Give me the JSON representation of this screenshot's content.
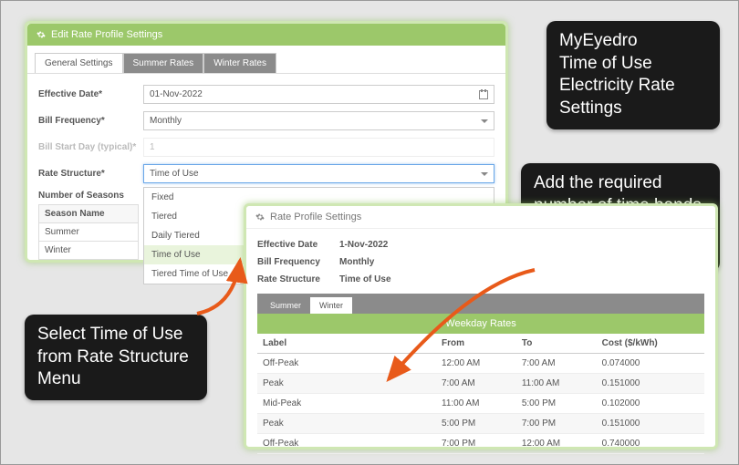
{
  "callouts": {
    "topRight": "MyEyedro\nTime of Use\nElectricity Rate\nSettings",
    "left": "Select Time of Use\nfrom Rate Structure\nMenu",
    "right": "Add the required\nnumber of time bands\n(select Edit Rate\nProfile Settings)"
  },
  "panel1": {
    "title": "Edit Rate Profile Settings",
    "tabs": [
      "General Settings",
      "Summer Rates",
      "Winter Rates"
    ],
    "activeTab": 0,
    "fields": {
      "effectiveDate": {
        "label": "Effective Date*",
        "value": "01-Nov-2022"
      },
      "billFrequency": {
        "label": "Bill Frequency*",
        "value": "Monthly"
      },
      "billStartDay": {
        "label": "Bill Start Day (typical)*",
        "value": "1"
      },
      "rateStructure": {
        "label": "Rate Structure*",
        "value": "Time of Use"
      },
      "numSeasons": {
        "label": "Number of Seasons"
      }
    },
    "rateStructureOptions": [
      "Fixed",
      "Tiered",
      "Daily Tiered",
      "Time of Use",
      "Tiered Time of Use"
    ],
    "rateStructureHighlight": 3,
    "seasonHeader": "Season Name",
    "seasons": [
      "Summer",
      "Winter"
    ]
  },
  "panel2": {
    "title": "Rate Profile Settings",
    "fields": {
      "effectiveDate": {
        "label": "Effective Date",
        "value": "1-Nov-2022"
      },
      "billFrequency": {
        "label": "Bill Frequency",
        "value": "Monthly"
      },
      "rateStructure": {
        "label": "Rate Structure",
        "value": "Time of Use"
      }
    },
    "tabs": [
      "Summer",
      "Winter"
    ],
    "activeTab": 1,
    "ratesTitle": "Weekday Rates",
    "columns": [
      "Label",
      "From",
      "To",
      "Cost ($/kWh)"
    ],
    "rows": [
      {
        "label": "Off-Peak",
        "from": "12:00 AM",
        "to": "7:00 AM",
        "cost": "0.074000"
      },
      {
        "label": "Peak",
        "from": "7:00 AM",
        "to": "11:00 AM",
        "cost": "0.151000"
      },
      {
        "label": "Mid-Peak",
        "from": "11:00 AM",
        "to": "5:00 PM",
        "cost": "0.102000"
      },
      {
        "label": "Peak",
        "from": "5:00 PM",
        "to": "7:00 PM",
        "cost": "0.151000"
      },
      {
        "label": "Off-Peak",
        "from": "7:00 PM",
        "to": "12:00 AM",
        "cost": "0.740000"
      }
    ]
  },
  "chart_data": {
    "type": "table",
    "title": "Weekday Rates",
    "columns": [
      "Label",
      "From",
      "To",
      "Cost ($/kWh)"
    ],
    "rows": [
      [
        "Off-Peak",
        "12:00 AM",
        "7:00 AM",
        0.074
      ],
      [
        "Peak",
        "7:00 AM",
        "11:00 AM",
        0.151
      ],
      [
        "Mid-Peak",
        "11:00 AM",
        "5:00 PM",
        0.102
      ],
      [
        "Peak",
        "5:00 PM",
        "7:00 PM",
        0.151
      ],
      [
        "Off-Peak",
        "7:00 PM",
        "12:00 AM",
        0.74
      ]
    ]
  }
}
